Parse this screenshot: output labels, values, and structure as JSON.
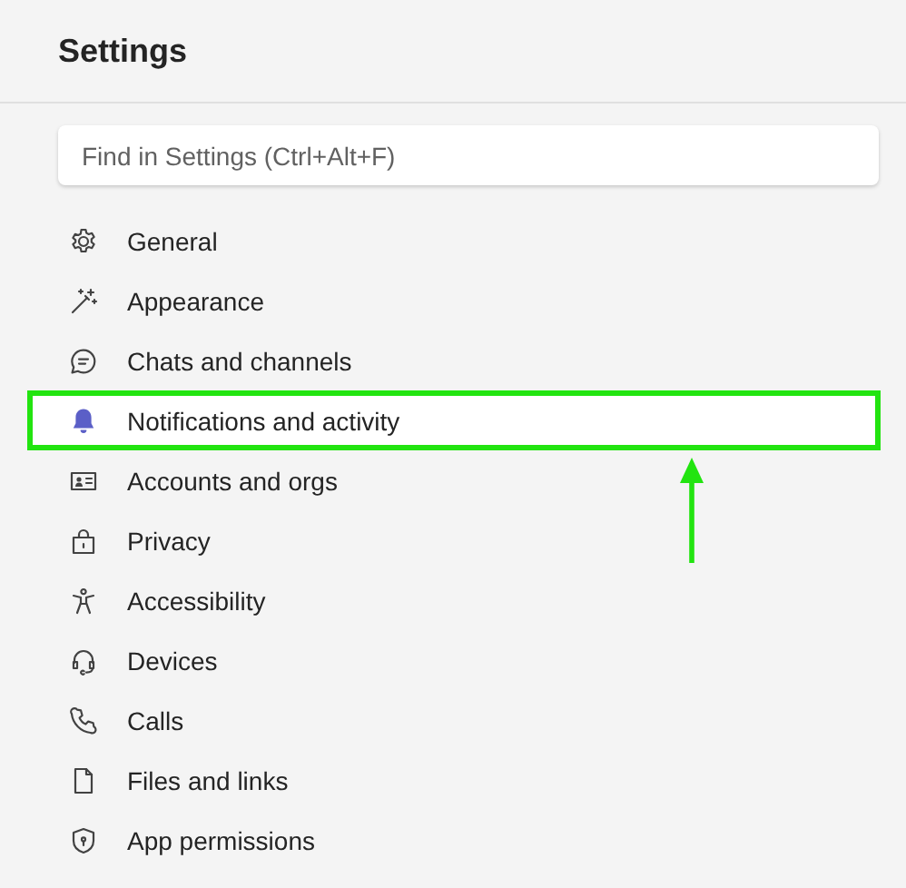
{
  "title": "Settings",
  "search": {
    "placeholder": "Find in Settings (Ctrl+Alt+F)"
  },
  "items": [
    {
      "label": "General",
      "selected": false
    },
    {
      "label": "Appearance",
      "selected": false
    },
    {
      "label": "Chats and channels",
      "selected": false
    },
    {
      "label": "Notifications and activity",
      "selected": true
    },
    {
      "label": "Accounts and orgs",
      "selected": false
    },
    {
      "label": "Privacy",
      "selected": false
    },
    {
      "label": "Accessibility",
      "selected": false
    },
    {
      "label": "Devices",
      "selected": false
    },
    {
      "label": "Calls",
      "selected": false
    },
    {
      "label": "Files and links",
      "selected": false
    },
    {
      "label": "App permissions",
      "selected": false
    }
  ]
}
